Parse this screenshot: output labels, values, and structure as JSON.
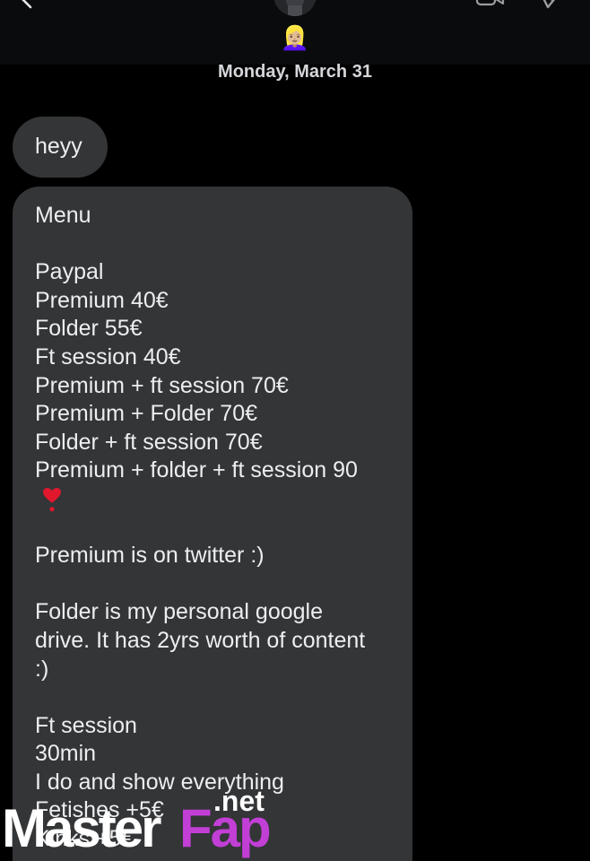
{
  "header": {
    "back_icon": "chevron-left-icon",
    "video_icon": "video-camera-icon",
    "info_icon": "shield-icon",
    "emoji": "👱🏼‍♀️",
    "date": "Monday, March 31"
  },
  "messages": [
    {
      "text": "heyy"
    },
    {
      "lines": [
        "Menu",
        "",
        "Paypal",
        "Premium 40€",
        "Folder 55€",
        "Ft session 40€",
        "Premium + ft session 70€",
        "Premium + Folder 70€",
        "Folder + ft session 70€",
        "Premium + folder + ft session 90",
        "❣️",
        "",
        "Premium is on twitter :)",
        "",
        "Folder is my personal google",
        "drive. It has 2yrs worth of content",
        ":)",
        "",
        "Ft session",
        "30min",
        "I do and show everything",
        "Fetishes +5€",
        "Kinks +5€"
      ]
    }
  ],
  "watermark": {
    "brand_part1": "Master",
    "brand_part2": "Fap",
    "suffix": ".net",
    "accent_color": "#c23fd6"
  }
}
